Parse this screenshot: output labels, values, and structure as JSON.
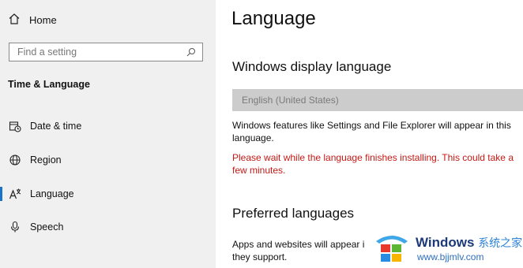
{
  "sidebar": {
    "home_label": "Home",
    "search_placeholder": "Find a setting",
    "section_title": "Time & Language",
    "items": [
      {
        "label": "Date & time",
        "icon": "calendar-clock-icon"
      },
      {
        "label": "Region",
        "icon": "globe-icon"
      },
      {
        "label": "Language",
        "icon": "language-icon"
      },
      {
        "label": "Speech",
        "icon": "microphone-icon"
      }
    ],
    "active_item": "Language"
  },
  "main": {
    "title": "Language",
    "display_language": {
      "heading": "Windows display language",
      "selected": "English (United States)",
      "description": "Windows features like Settings and File Explorer will appear in this language.",
      "warning": "Please wait while the language finishes installing. This could take a few minutes."
    },
    "preferred": {
      "heading": "Preferred languages",
      "description_visible": "Apps and websites will appear i",
      "description_line2": "they support."
    }
  },
  "watermark": {
    "brand": "Windows",
    "brand_cn": "系统之家",
    "url": "www.bjjmlv.com"
  },
  "colors": {
    "accent": "#1a73c9",
    "warning": "#c41a16",
    "sidebar_bg": "#f0f0f0"
  }
}
